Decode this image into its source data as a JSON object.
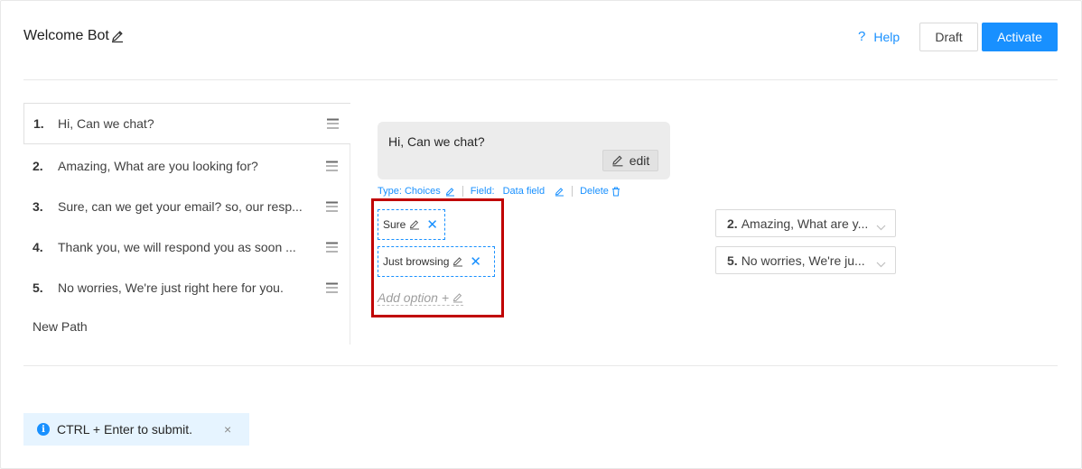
{
  "header": {
    "title": "Welcome Bot",
    "help_label": "Help",
    "draft_label": "Draft",
    "activate_label": "Activate"
  },
  "steps": [
    {
      "num": "1.",
      "text": "Hi, Can we chat?"
    },
    {
      "num": "2.",
      "text": "Amazing, What are you looking for?"
    },
    {
      "num": "3.",
      "text": "Sure, can we get your email? so, our resp..."
    },
    {
      "num": "4.",
      "text": "Thank you, we will respond you as soon ..."
    },
    {
      "num": "5.",
      "text": "No worries, We're just right here for you."
    }
  ],
  "new_path_label": "New Path",
  "message": {
    "text": "Hi, Can we chat?",
    "edit_label": "edit",
    "type_label": "Type: Choices",
    "field_label": "Field:",
    "field_value": "Data field",
    "delete_label": "Delete"
  },
  "options": [
    {
      "label": "Sure"
    },
    {
      "label": "Just browsing"
    }
  ],
  "add_option_label": "Add option +",
  "destinations": [
    {
      "num": "2.",
      "text": "Amazing, What are y..."
    },
    {
      "num": "5.",
      "text": "No worries, We're ju..."
    }
  ],
  "toast": {
    "message": "CTRL + Enter to submit.",
    "info_glyph": "i",
    "close_glyph": "×"
  },
  "colors": {
    "accent": "#1890ff",
    "highlight_box": "#c00000"
  }
}
